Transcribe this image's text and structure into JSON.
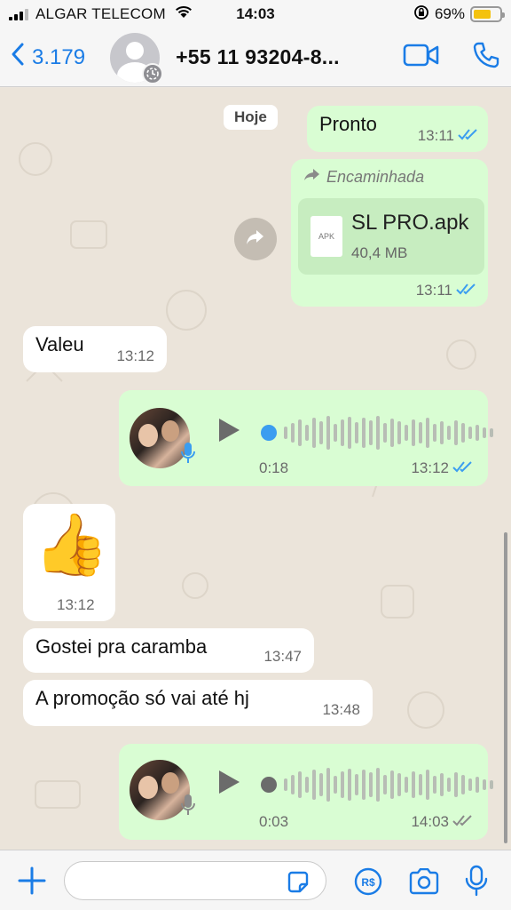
{
  "status_bar": {
    "carrier": "ALGAR TELECOM",
    "time": "14:03",
    "battery_percent_label": "69%",
    "battery_level": 0.69
  },
  "header": {
    "back_count": "3.179",
    "contact_name": "+55 11 93204-8...",
    "accent_color": "#1a7ce6"
  },
  "chat": {
    "date_label": "Hoje",
    "messages": [
      {
        "direction": "out",
        "type": "text",
        "text": "Pronto",
        "time": "13:11",
        "status": "read"
      },
      {
        "direction": "out",
        "type": "file",
        "forwarded_label": "Encaminhada",
        "file_type": "APK",
        "file_name": "SL PRO.apk",
        "file_size": "40,4 MB",
        "time": "13:11",
        "status": "read"
      },
      {
        "direction": "in",
        "type": "text",
        "text": "Valeu",
        "time": "13:12"
      },
      {
        "direction": "out",
        "type": "voice",
        "duration": "0:18",
        "time": "13:12",
        "status": "read",
        "played": true
      },
      {
        "direction": "in",
        "type": "emoji",
        "text": "👍",
        "time": "13:12"
      },
      {
        "direction": "in",
        "type": "text",
        "text": "Gostei pra caramba",
        "time": "13:47"
      },
      {
        "direction": "in",
        "type": "text",
        "text": "A promoção só vai até hj",
        "time": "13:48"
      },
      {
        "direction": "out",
        "type": "voice",
        "duration": "0:03",
        "time": "14:03",
        "status": "delivered",
        "played": false
      }
    ]
  },
  "input_bar": {
    "message_placeholder": ""
  },
  "icons": {
    "back": "chevron-left-icon",
    "video": "video-camera-icon",
    "call": "phone-icon",
    "add": "plus-icon",
    "sticker": "sticker-icon",
    "payment": "payment-icon",
    "camera": "camera-icon",
    "mic": "microphone-icon",
    "forward": "forward-arrow-icon",
    "play": "play-icon"
  },
  "colors": {
    "outgoing_bubble": "#d9fdd3",
    "incoming_bubble": "#ffffff",
    "read_ticks": "#3b9df0",
    "chat_background": "#ebe4da"
  }
}
